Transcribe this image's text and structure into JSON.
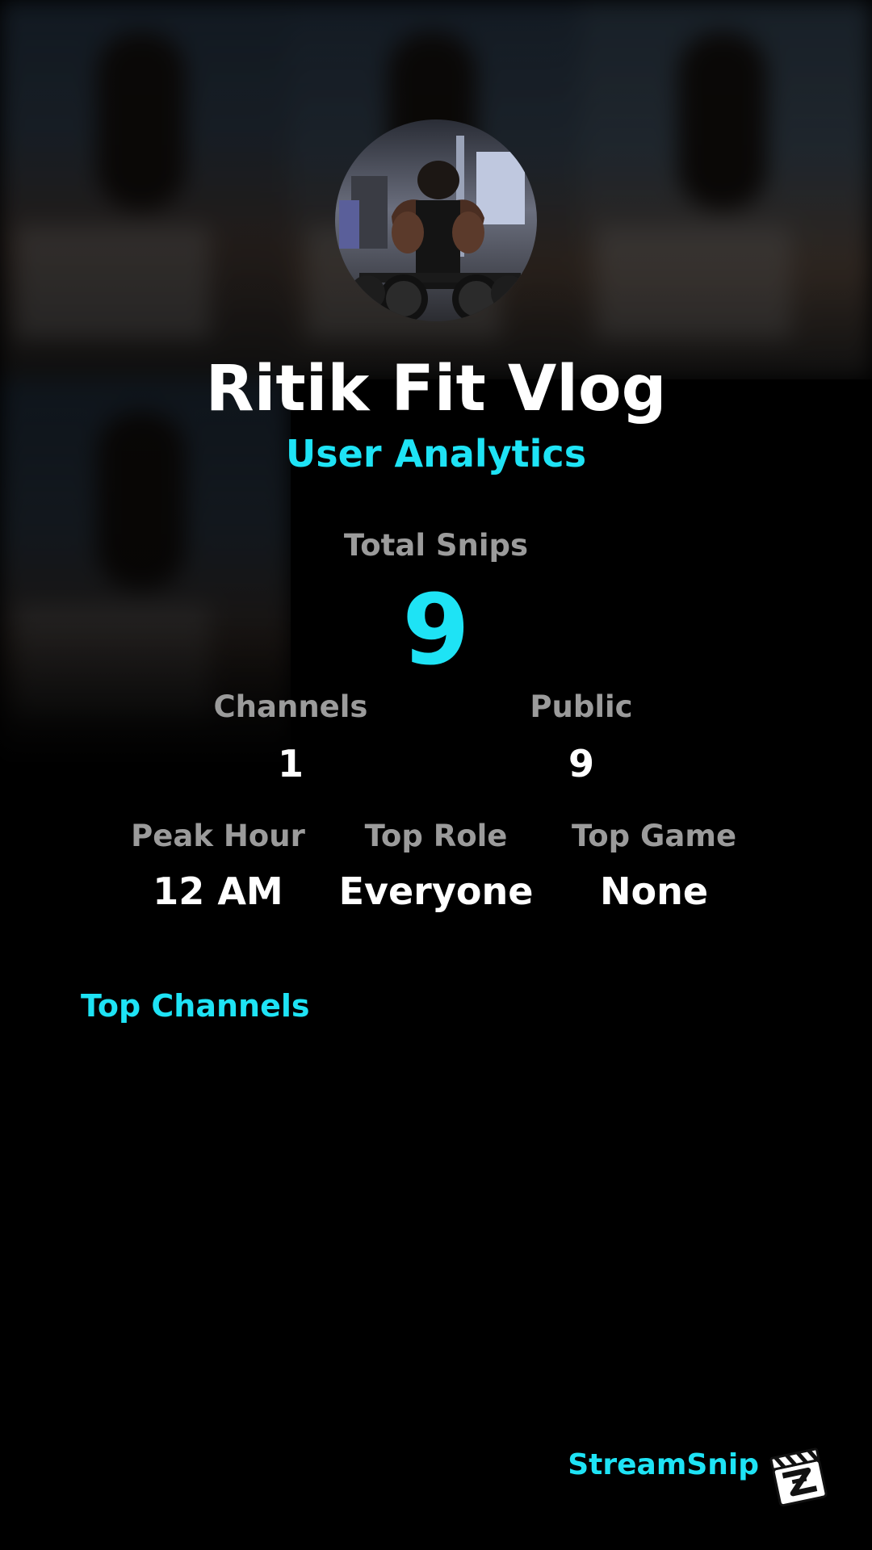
{
  "profile": {
    "display_name": "Ritik Fit Vlog",
    "subtitle": "User Analytics",
    "avatar_icon": "profile-photo-gym-icon"
  },
  "stats": {
    "total_snips_label": "Total Snips",
    "total_snips_value": "9",
    "channels_label": "Channels",
    "channels_value": "1",
    "public_label": "Public",
    "public_value": "9",
    "peak_hour_label": "Peak Hour",
    "peak_hour_value": "12 AM",
    "top_role_label": "Top Role",
    "top_role_value": "Everyone",
    "top_game_label": "Top Game",
    "top_game_value": "None"
  },
  "sections": {
    "top_channels_label": "Top Channels"
  },
  "branding": {
    "name": "StreamSnip",
    "logo_icon": "clapperboard-logo-icon"
  },
  "colors": {
    "accent": "#1ee3f5",
    "label": "#9b9b9b",
    "value": "#ffffff",
    "background": "#000000"
  }
}
